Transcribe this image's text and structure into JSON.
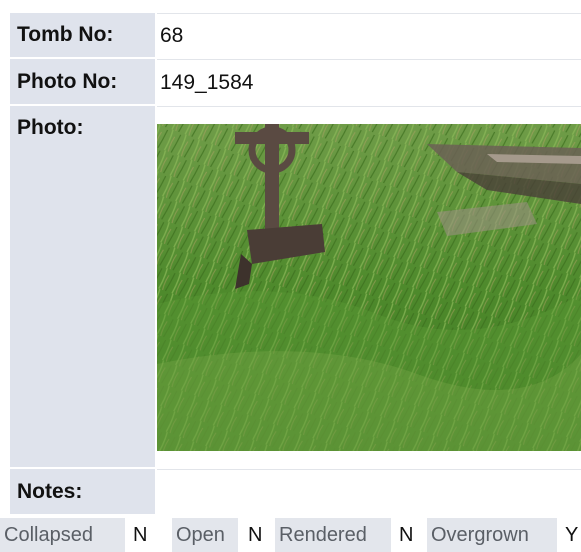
{
  "record": {
    "tomb_label": "Tomb No:",
    "tomb_value": "68",
    "photo_no_label": "Photo No:",
    "photo_no_value": "149_1584",
    "photo_label": "Photo:",
    "notes_label": "Notes:",
    "notes_value": ""
  },
  "photo": {
    "icon": "celtic-cross-headstone-in-grass",
    "colors": {
      "grass": "#4f8a2e",
      "stone": "#5a4a42",
      "sky_slab": "#8b7d70"
    }
  },
  "status": [
    {
      "label": "Collapsed",
      "value": "N"
    },
    {
      "label": "Open",
      "value": "N"
    },
    {
      "label": "Rendered",
      "value": "N"
    },
    {
      "label": "Overgrown",
      "value": "Y"
    }
  ],
  "colors": {
    "label_bg": "#dfe3ec",
    "status_bg": "#e3e6ec"
  }
}
